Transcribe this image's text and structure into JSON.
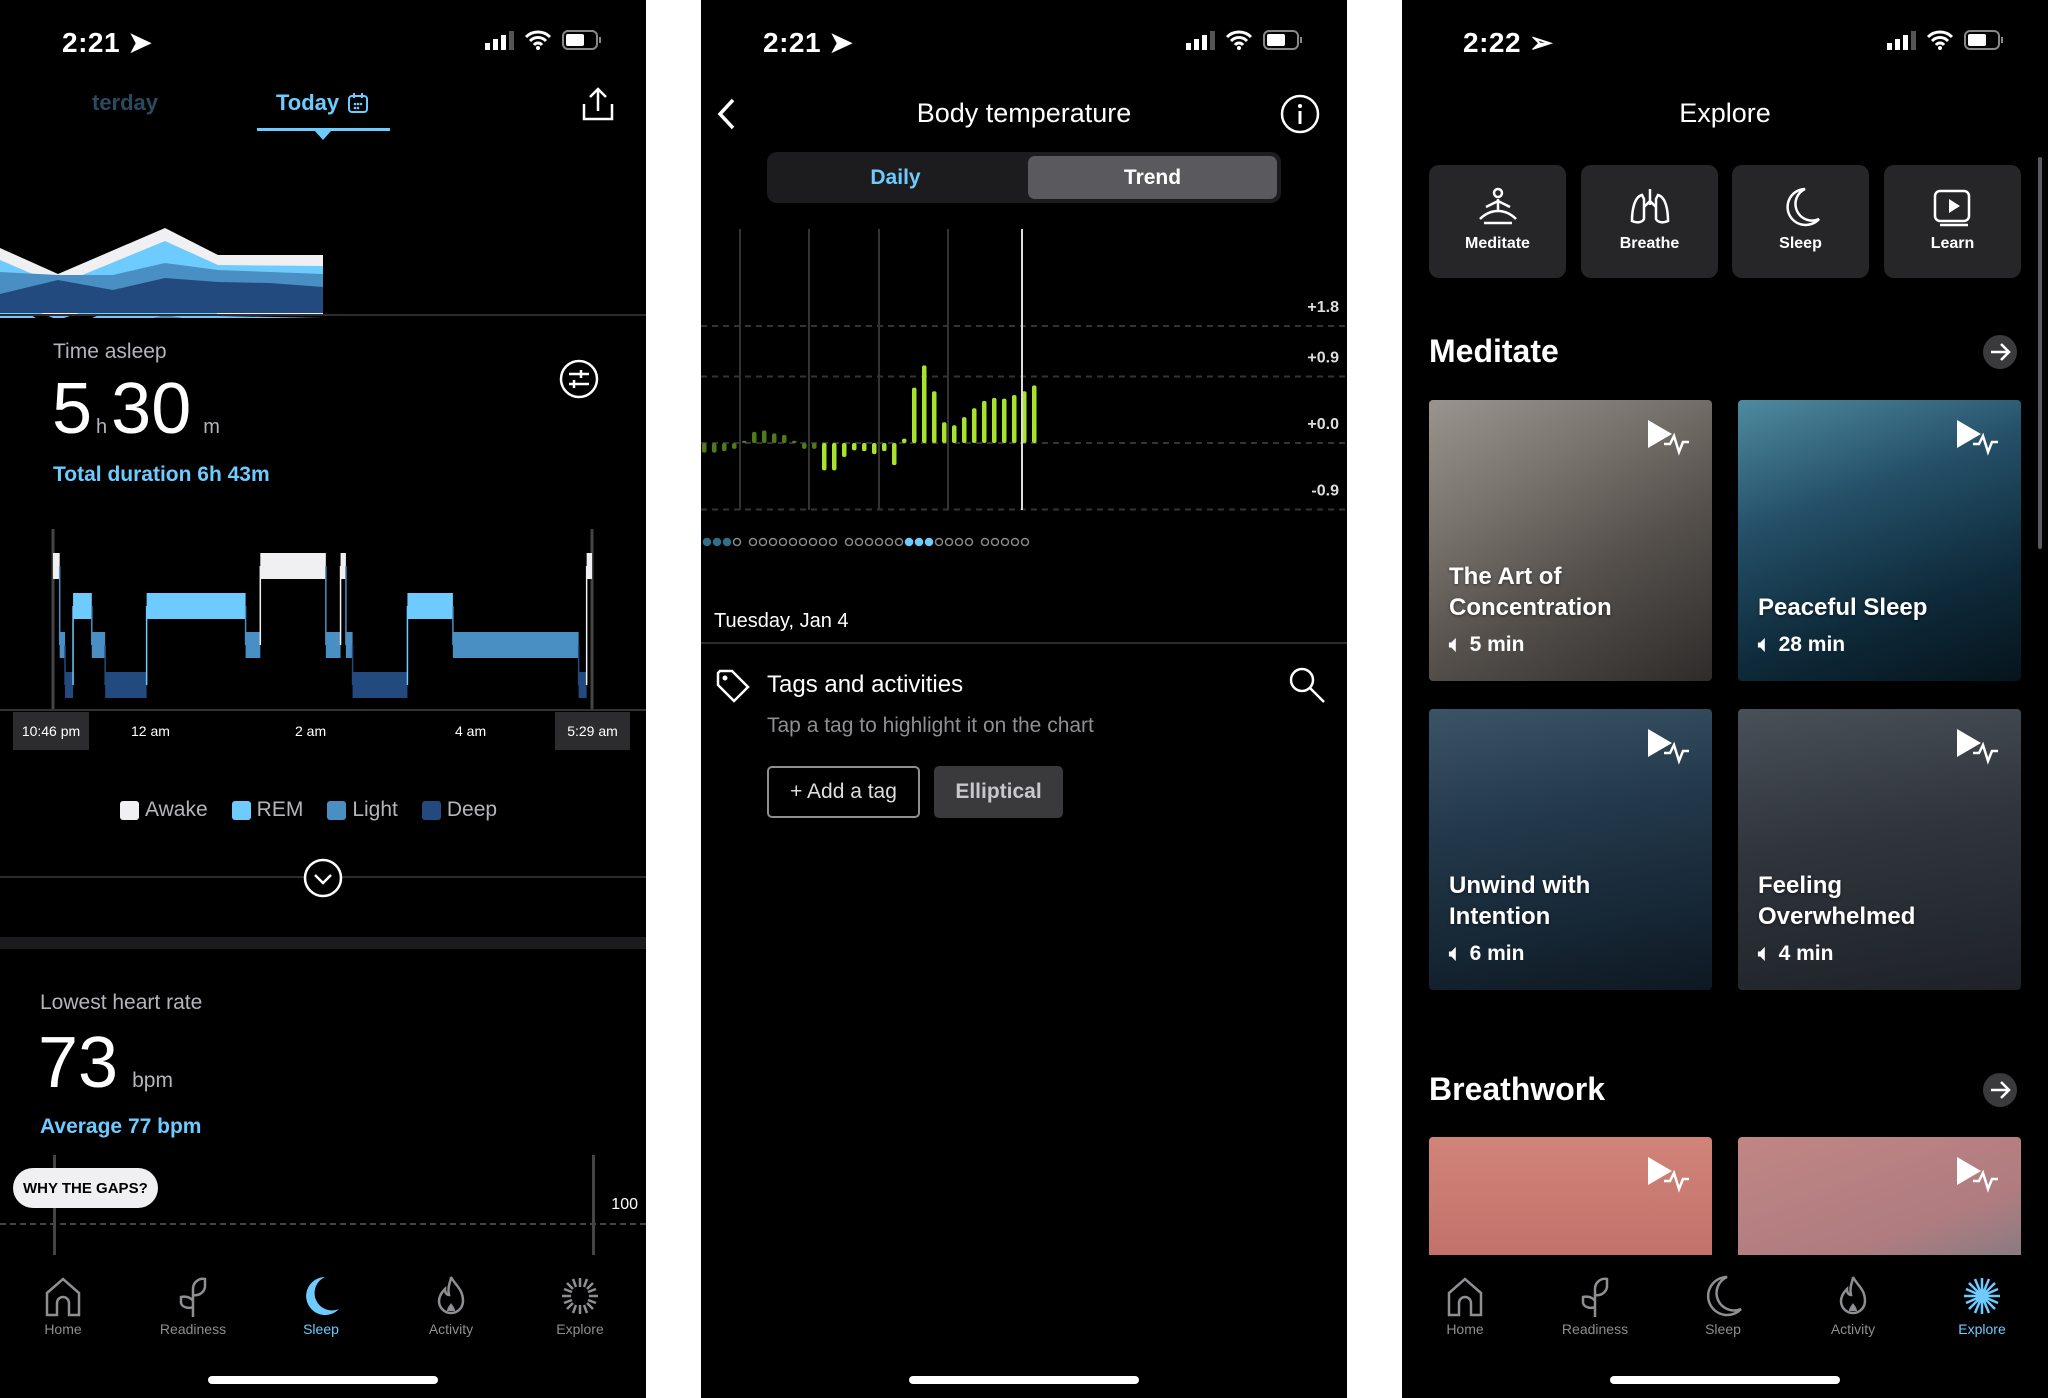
{
  "colors": {
    "accent": "#6ecbff",
    "awake": "#f0f0f2",
    "rem": "#6ecbff",
    "light": "#4a8fc4",
    "deep": "#234a7e",
    "temp_bar": "#a6e22e",
    "temp_bar_dim": "#4f7a1a"
  },
  "tabbar": [
    {
      "label": "Home",
      "icon": "home-icon"
    },
    {
      "label": "Readiness",
      "icon": "sprout-icon"
    },
    {
      "label": "Sleep",
      "icon": "moon-icon"
    },
    {
      "label": "Activity",
      "icon": "flame-icon"
    },
    {
      "label": "Explore",
      "icon": "sparkle-icon"
    }
  ],
  "sleep": {
    "status_time": "2:21",
    "tabs": {
      "previous": "terday",
      "current": "Today"
    },
    "time_asleep_label": "Time asleep",
    "hours": "5",
    "hours_unit": "h",
    "minutes": "30",
    "minutes_unit": "m",
    "total_duration": "Total duration 6h 43m",
    "hypnogram": {
      "start_label": "10:46 pm",
      "end_label": "5:29 am",
      "ticks": [
        "12 am",
        "2 am",
        "4 am"
      ],
      "start": "22:46",
      "end": "05:29",
      "segments": [
        [
          "awake",
          "22:46",
          "22:51"
        ],
        [
          "light",
          "22:51",
          "22:55"
        ],
        [
          "deep",
          "22:55",
          "23:01"
        ],
        [
          "rem",
          "23:01",
          "23:15"
        ],
        [
          "light",
          "23:15",
          "23:25"
        ],
        [
          "deep",
          "23:25",
          "23:56"
        ],
        [
          "rem",
          "23:56",
          "01:10"
        ],
        [
          "light",
          "01:10",
          "01:21"
        ],
        [
          "awake",
          "01:21",
          "02:10"
        ],
        [
          "light",
          "02:10",
          "02:21"
        ],
        [
          "awake",
          "02:21",
          "02:25"
        ],
        [
          "light",
          "02:25",
          "02:30"
        ],
        [
          "deep",
          "02:30",
          "03:11"
        ],
        [
          "rem",
          "03:11",
          "03:45"
        ],
        [
          "light",
          "03:45",
          "05:19"
        ],
        [
          "deep",
          "05:19",
          "05:25"
        ],
        [
          "awake",
          "05:25",
          "05:29"
        ]
      ],
      "legend": [
        {
          "key": "awake",
          "label": "Awake"
        },
        {
          "key": "rem",
          "label": "REM"
        },
        {
          "key": "light",
          "label": "Light"
        },
        {
          "key": "deep",
          "label": "Deep"
        }
      ]
    },
    "heart": {
      "label": "Lowest heart rate",
      "value": "73",
      "unit": "bpm",
      "average": "Average 77 bpm",
      "gaps_button": "WHY THE GAPS?",
      "axis_label": "100"
    },
    "active_tab": 2
  },
  "temperature": {
    "status_time": "2:21",
    "title": "Body temperature",
    "segments": [
      "Daily",
      "Trend"
    ],
    "selected_segment": "Trend",
    "chart_data": {
      "type": "bar",
      "ylim": [
        -0.9,
        1.8
      ],
      "y_ticks": [
        "+1.8",
        "+0.9",
        "+0.0",
        "-0.9"
      ],
      "y_tick_values": [
        1.8,
        0.9,
        0.0,
        -0.9
      ],
      "values": [
        -0.13,
        -0.13,
        -0.11,
        -0.08,
        0.03,
        0.15,
        0.17,
        0.13,
        0.11,
        0.03,
        -0.08,
        -0.08,
        -0.37,
        -0.37,
        -0.19,
        -0.1,
        -0.11,
        -0.15,
        -0.11,
        -0.3,
        0.06,
        0.75,
        1.05,
        0.7,
        0.28,
        0.24,
        0.35,
        0.47,
        0.57,
        0.61,
        0.6,
        0.65,
        0.7,
        0.78
      ],
      "grid": true
    },
    "activity_dots": [
      [
        "dark",
        "dark",
        "dark",
        "open"
      ],
      [
        "open",
        "open",
        "open",
        "open",
        "open",
        "open",
        "open",
        "open",
        "open"
      ],
      [
        "open",
        "open",
        "open",
        "open",
        "open",
        "open",
        "filled",
        "filled",
        "filled",
        "open",
        "open",
        "open",
        "open"
      ],
      [
        "open",
        "open",
        "open",
        "open",
        "open"
      ]
    ],
    "date": "Tuesday, Jan 4",
    "tags_title": "Tags and activities",
    "tags_hint": "Tap a tag to highlight it on the chart",
    "add_tag": "+ Add a tag",
    "tags": [
      "Elliptical"
    ]
  },
  "explore": {
    "status_time": "2:22",
    "title": "Explore",
    "categories": [
      {
        "label": "Meditate",
        "icon": "meditate-icon"
      },
      {
        "label": "Breathe",
        "icon": "lungs-icon"
      },
      {
        "label": "Sleep",
        "icon": "moon-icon"
      },
      {
        "label": "Learn",
        "icon": "play-video-icon"
      }
    ],
    "meditate_heading": "Meditate",
    "meditations": [
      {
        "title": "The Art of Concentration",
        "duration": "5 min"
      },
      {
        "title": "Peaceful Sleep",
        "duration": "28 min"
      },
      {
        "title": "Unwind with Intention",
        "duration": "6 min"
      },
      {
        "title": "Feeling Overwhelmed",
        "duration": "4 min"
      }
    ],
    "breathwork_heading": "Breathwork",
    "active_tab": 4
  }
}
